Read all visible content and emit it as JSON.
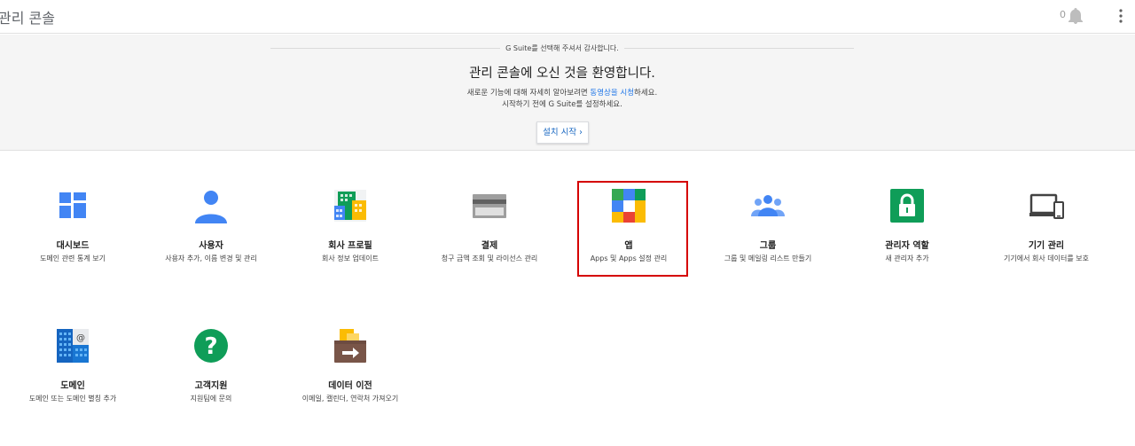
{
  "header": {
    "title": "관리 콘솔",
    "notification_count": "0",
    "icons": {
      "bell": "bell-icon",
      "more": "more-vert-icon"
    }
  },
  "banner": {
    "thanks": "G Suite를 선택해 주셔서 감사합니다.",
    "welcome": "관리 콘솔에 오신 것을 환영합니다.",
    "line1_before": "새로운 기능에 대해 자세히 알아보려면 ",
    "line1_link": "동영상을 시청",
    "line1_after": "하세요.",
    "line2": "시작하기 전에 G Suite를 설정하세요.",
    "start_button": "설치 시작 ›"
  },
  "tiles": [
    {
      "title": "대시보드",
      "desc": "도메인 관련 통계 보기",
      "icon": "dashboard-icon"
    },
    {
      "title": "사용자",
      "desc": "사용자 추가, 이름 변경 및 관리",
      "icon": "user-icon"
    },
    {
      "title": "회사 프로필",
      "desc": "회사 정보 업데이트",
      "icon": "company-profile-icon"
    },
    {
      "title": "결제",
      "desc": "청구 금액 조회 및 라이선스 관리",
      "icon": "billing-card-icon"
    },
    {
      "title": "앱",
      "desc": "Apps 및 Apps 설정 관리",
      "icon": "apps-icon"
    },
    {
      "title": "그룹",
      "desc": "그룹 및 메일링 리스트 만들기",
      "icon": "groups-icon"
    },
    {
      "title": "관리자 역할",
      "desc": "새 관리자 추가",
      "icon": "admin-lock-icon"
    },
    {
      "title": "기기 관리",
      "desc": "기기에서 회사 데이터를 보호",
      "icon": "devices-icon"
    },
    {
      "title": "도메인",
      "desc": "도메인 또는 도메인 별칭 추가",
      "icon": "domain-building-icon"
    },
    {
      "title": "고객지원",
      "desc": "지원팀에 문의",
      "icon": "help-icon"
    },
    {
      "title": "데이터 이전",
      "desc": "이메일, 캘린더, 연락처 가져오기",
      "icon": "data-migration-icon"
    }
  ],
  "colors": {
    "highlight": "#d50000",
    "link": "#1a73e8",
    "blue": "#4285f4",
    "green": "#0f9d58"
  }
}
